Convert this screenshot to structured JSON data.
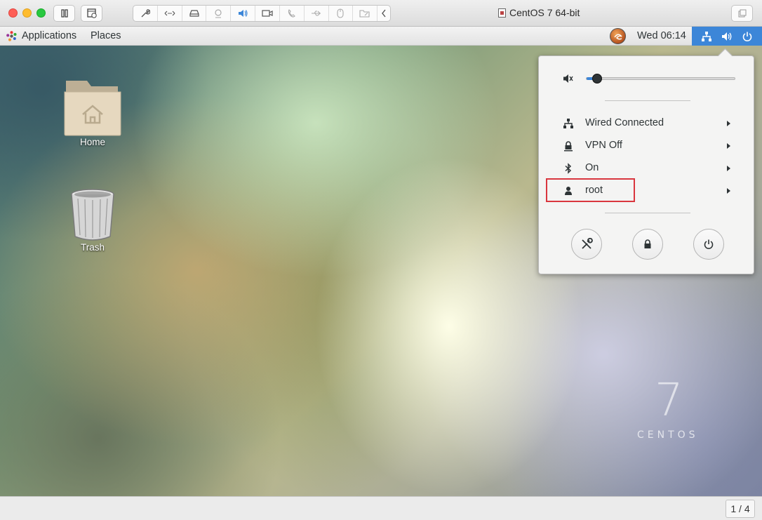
{
  "window": {
    "title": "CentOS 7 64-bit",
    "toolbar_icons": [
      "pause-icon",
      "snapshot-icon",
      "settings-wrench-icon",
      "network-arrows-icon",
      "hard-disk-icon",
      "camera-icon",
      "sound-icon",
      "video-camera-icon",
      "audio-input-icon",
      "usb-icon",
      "mouse-icon",
      "shared-folder-icon",
      "collapse-chevron-icon",
      "fullscreen-icon"
    ]
  },
  "gnome_bar": {
    "applications": "Applications",
    "places": "Places",
    "clock": "Wed 06:14"
  },
  "desktop": {
    "icons": [
      {
        "label": "Home"
      },
      {
        "label": "Trash"
      }
    ],
    "branding_number": "7",
    "branding_word": "CENTOS"
  },
  "system_menu": {
    "volume_level": 0.07,
    "items": [
      {
        "label": "Wired Connected",
        "icon": "wired-network-icon"
      },
      {
        "label": "VPN Off",
        "icon": "vpn-lock-icon"
      },
      {
        "label": "On",
        "icon": "bluetooth-icon"
      },
      {
        "label": "root",
        "icon": "user-icon"
      }
    ],
    "actions": [
      "settings-icon",
      "lock-icon",
      "power-icon"
    ]
  },
  "status_bar": {
    "page": "1 / 4"
  },
  "colors": {
    "accent": "#3c86d8",
    "highlight": "#d9363e"
  }
}
